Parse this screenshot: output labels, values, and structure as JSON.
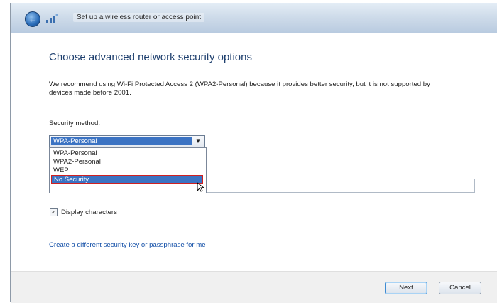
{
  "window": {
    "title": "Set up a wireless router or access point"
  },
  "icons": {
    "back": "back-arrow-icon",
    "wifi": "wireless-network-icon"
  },
  "page": {
    "heading": "Choose advanced network security options",
    "intro": "We recommend using Wi-Fi Protected Access 2 (WPA2-Personal) because it provides better security,  but it is not supported by devices made before 2001.",
    "security_label": "Security method:",
    "security_selected": "WPA-Personal",
    "security_options": [
      "WPA-Personal",
      "WPA2-Personal",
      "WEP",
      "No Security"
    ],
    "highlighted_option": "No Security",
    "display_chars_label": "Display characters",
    "display_chars_checked": true,
    "link": "Create a different security key or passphrase for me"
  },
  "footer": {
    "next": "Next",
    "cancel": "Cancel"
  },
  "colors": {
    "title_blue": "#1e3f6e",
    "selection_blue": "#3b73c3",
    "highlight_border": "#d02020",
    "link_blue": "#1450a8"
  }
}
